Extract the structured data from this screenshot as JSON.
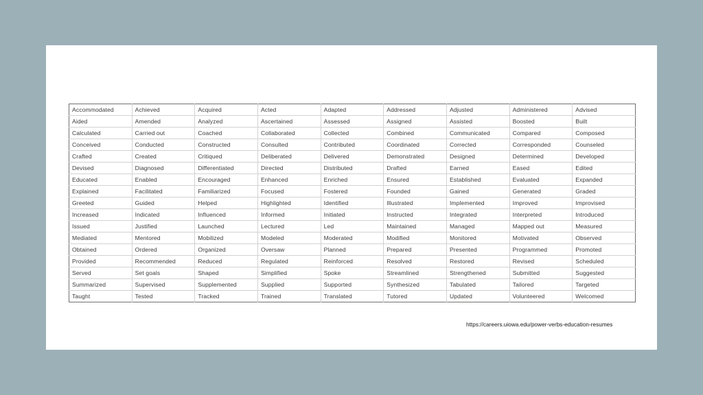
{
  "slide": {
    "background_color": "#9cb0b8",
    "canvas_color": "#ffffff",
    "source_url": "https://careers.uiowa.edu/power-verbs-education-resumes"
  },
  "verb_table": {
    "columns": 9,
    "rows_count": 18,
    "border_color": "#d2d2d2",
    "outer_border_color": "#70706f",
    "text_color": "#3c3c3b",
    "rows": [
      [
        "Accommodated",
        "Achieved",
        "Acquired",
        "Acted",
        "Adapted",
        "Addressed",
        "Adjusted",
        "Administered",
        "Advised"
      ],
      [
        "Aided",
        "Amended",
        "Analyzed",
        "Ascertained",
        "Assessed",
        "Assigned",
        "Assisted",
        "Boosted",
        "Built"
      ],
      [
        "Calculated",
        "Carried out",
        "Coached",
        "Collaborated",
        "Collected",
        "Combined",
        "Communicated",
        "Compared",
        "Composed"
      ],
      [
        "Conceived",
        "Conducted",
        "Constructed",
        "Consulted",
        "Contributed",
        "Coordinated",
        "Corrected",
        "Corresponded",
        "Counseled"
      ],
      [
        "Crafted",
        "Created",
        "Critiqued",
        "Deliberated",
        "Delivered",
        "Demonstrated",
        "Designed",
        "Determined",
        "Developed"
      ],
      [
        "Devised",
        "Diagnosed",
        "Differentiated",
        "Directed",
        "Distributed",
        "Drafted",
        "Earned",
        "Eased",
        "Edited"
      ],
      [
        "Educated",
        "Enabled",
        "Encouraged",
        "Enhanced",
        "Enriched",
        "Ensured",
        "Established",
        "Evaluated",
        "Expanded"
      ],
      [
        "Explained",
        "Facilitated",
        "Familiarized",
        "Focused",
        "Fostered",
        "Founded",
        "Gained",
        "Generated",
        "Graded"
      ],
      [
        "Greeted",
        "Guided",
        "Helped",
        "Highlighted",
        "Identified",
        "Illustrated",
        "Implemented",
        "Improved",
        "Improvised"
      ],
      [
        "Increased",
        "Indicated",
        "Influenced",
        "Informed",
        "Initiated",
        "Instructed",
        "Integrated",
        "Interpreted",
        "Introduced"
      ],
      [
        "Issued",
        "Justified",
        "Launched",
        "Lectured",
        "Led",
        "Maintained",
        "Managed",
        "Mapped out",
        "Measured"
      ],
      [
        "Mediated",
        "Mentored",
        "Mobilized",
        "Modeled",
        "Moderated",
        "Modified",
        "Monitored",
        "Motivated",
        "Observed"
      ],
      [
        "Obtained",
        "Ordered",
        "Organized",
        "Oversaw",
        "Planned",
        "Prepared",
        "Presented",
        "Programmed",
        "Promoted"
      ],
      [
        "Provided",
        "Recommended",
        "Reduced",
        "Regulated",
        "Reinforced",
        "Resolved",
        "Restored",
        "Revised",
        "Scheduled"
      ],
      [
        "Served",
        "Set goals",
        "Shaped",
        "Simplified",
        "Spoke",
        "Streamlined",
        "Strengthened",
        "Submitted",
        "Suggested"
      ],
      [
        "Summarized",
        "Supervised",
        "Supplemented",
        "Supplied",
        "Supported",
        "Synthesized",
        "Tabulated",
        "Tailored",
        "Targeted"
      ],
      [
        "Taught",
        "Tested",
        "Tracked",
        "Trained",
        "Translated",
        "Tutored",
        "Updated",
        "Volunteered",
        "Welcomed"
      ]
    ]
  }
}
